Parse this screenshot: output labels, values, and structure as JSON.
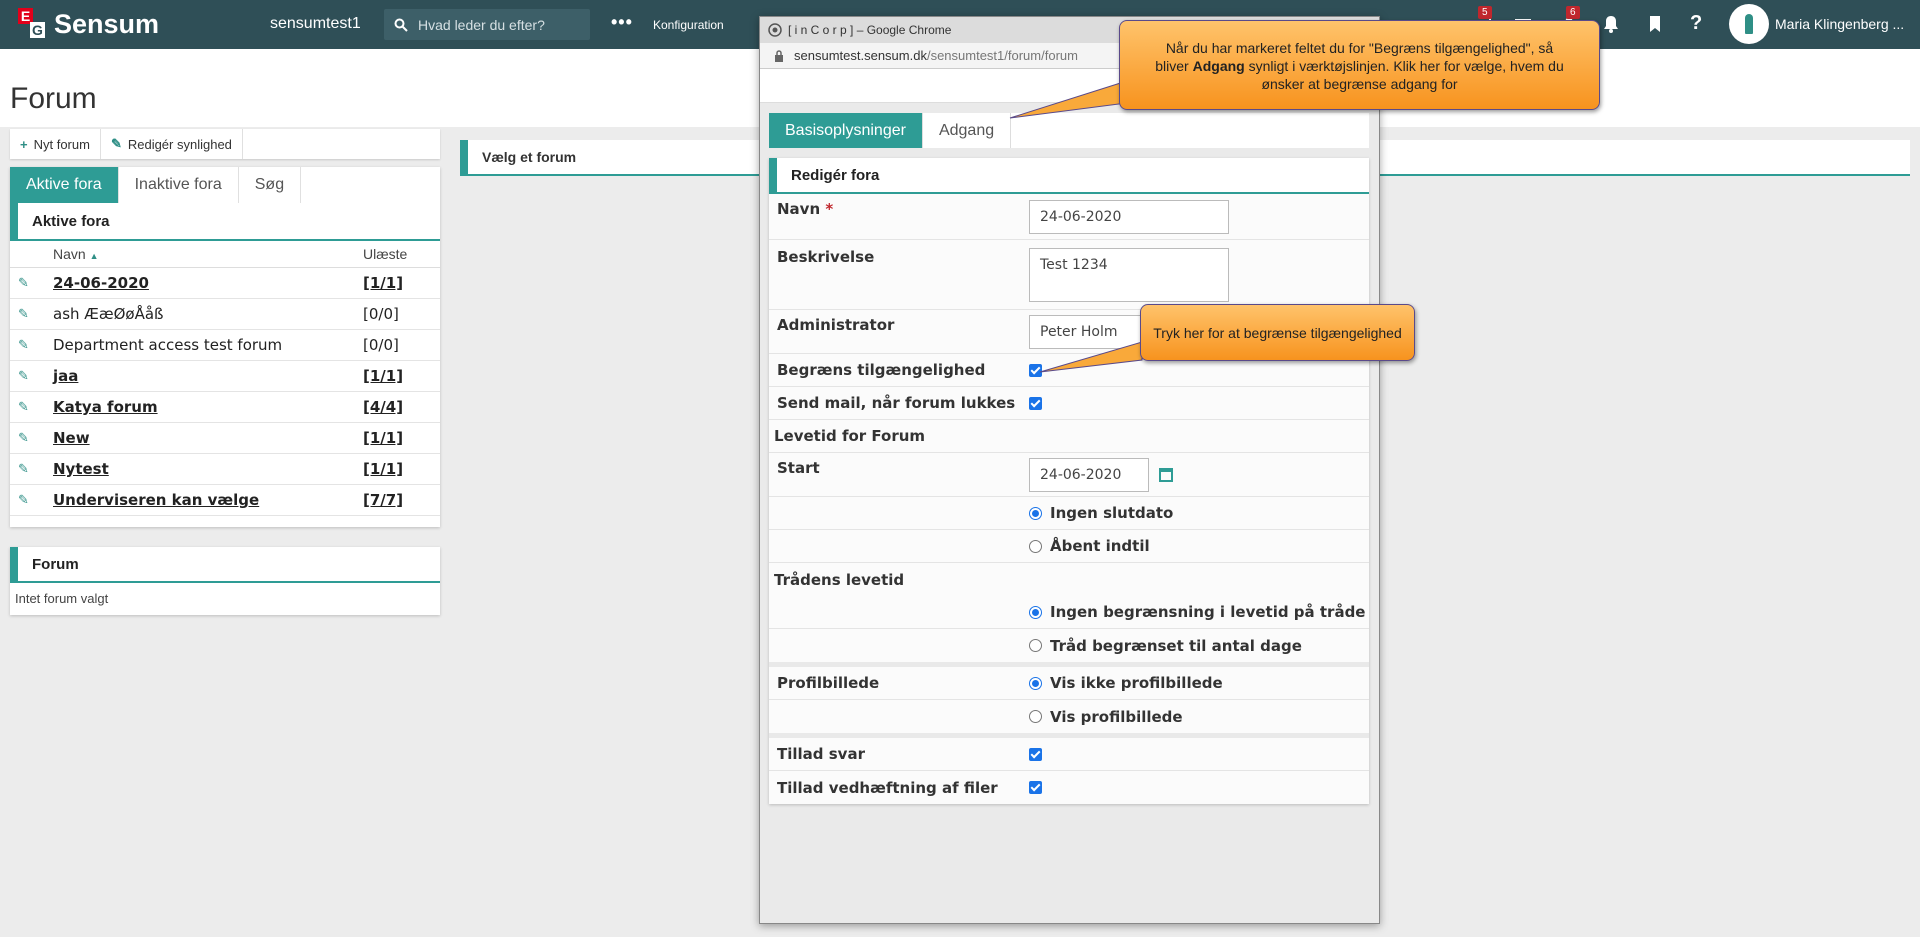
{
  "topbar": {
    "logo_e": "E",
    "logo_g": "G",
    "logo_text": "Sensum",
    "tenant": "sensumtest1",
    "search_placeholder": "Hvad leder du efter?",
    "more": "•••",
    "config": "Konfiguration",
    "badge_1": "5",
    "badge_2": "6",
    "help": "?",
    "user": "Maria Klingenberg ..."
  },
  "page": {
    "title": "Forum"
  },
  "toolbar": {
    "new_forum": "Nyt forum",
    "edit_visibility": "Redigér synlighed"
  },
  "left_tabs": [
    "Aktive fora",
    "Inaktive fora",
    "Søg"
  ],
  "active_forums": {
    "heading": "Aktive fora",
    "col_name": "Navn",
    "col_unread": "Ulæste",
    "rows": [
      {
        "name": "24-06-2020",
        "unread": "[1/1]",
        "bold": true
      },
      {
        "name": "ash ÆæØøÅåß",
        "unread": "[0/0]",
        "bold": false
      },
      {
        "name": "Department access test forum",
        "unread": "[0/0]",
        "bold": false
      },
      {
        "name": "jaa",
        "unread": "[1/1]",
        "bold": true
      },
      {
        "name": "Katya forum",
        "unread": "[4/4]",
        "bold": true
      },
      {
        "name": "New",
        "unread": "[1/1]",
        "bold": true
      },
      {
        "name": "Nytest",
        "unread": "[1/1]",
        "bold": true
      },
      {
        "name": "Underviseren kan vælge",
        "unread": "[7/7]",
        "bold": true
      }
    ]
  },
  "forum_panel": {
    "heading": "Forum",
    "empty": "Intet forum valgt"
  },
  "select_forum": "Vælg et forum",
  "popup": {
    "title": "[ i n C o r p ] – Google Chrome",
    "url_host": "sensumtest.sensum.dk",
    "url_path": "/sensumtest1/forum/forum",
    "tabs": [
      "Basisoplysninger",
      "Adgang"
    ],
    "form_heading": "Redigér fora",
    "name_label": "Navn",
    "required_mark": "*",
    "name_value": "24-06-2020",
    "desc_label": "Beskrivelse",
    "desc_value": "Test 1234",
    "admin_label": "Administrator",
    "admin_value": "Peter Holm",
    "restrict_label": "Begræns tilgængelighed",
    "mail_label": "Send mail, når forum lukkes",
    "lifetime_label": "Levetid for Forum",
    "start_label": "Start",
    "start_value": "24-06-2020",
    "no_end": "Ingen slutdato",
    "open_until": "Åbent indtil",
    "thread_life_label": "Trådens levetid",
    "no_limit": "Ingen begrænsning i levetid på tråde",
    "limit_days": "Tråd begrænset til antal dage",
    "profile_label": "Profilbillede",
    "hide_profile": "Vis ikke profilbillede",
    "show_profile": "Vis profilbillede",
    "allow_reply": "Tillad svar",
    "allow_attach": "Tillad vedhæftning af filer"
  },
  "callouts": {
    "top_1": "Når du har markeret feltet du for \"Begræns tilgængelighed\", så",
    "top_2a": "bliver ",
    "top_2b": "Adgang",
    "top_2c": " synligt i værktøjslinjen. Klik her for vælge, hvem du",
    "top_3": "ønsker at begrænse adgang for",
    "mid": "Tryk her for at begrænse tilgængelighed"
  }
}
